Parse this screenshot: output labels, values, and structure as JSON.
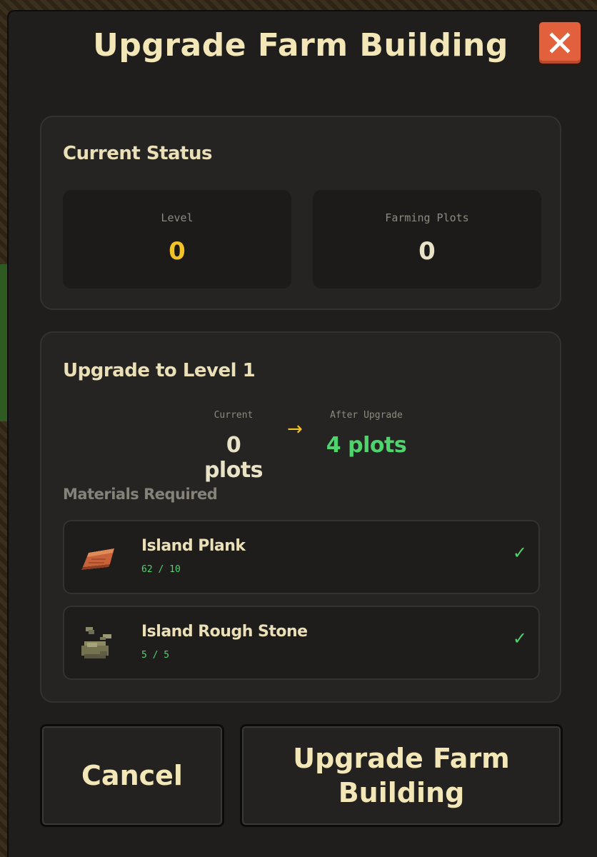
{
  "modal": {
    "title": "Upgrade Farm Building",
    "close_icon": "close-icon"
  },
  "current_status": {
    "heading": "Current Status",
    "level_label": "Level",
    "level_value": "0",
    "plots_label": "Farming Plots",
    "plots_value": "0"
  },
  "upgrade": {
    "heading": "Upgrade to Level 1",
    "current_label": "Current",
    "current_value": "0 plots",
    "arrow": "→",
    "after_label": "After Upgrade",
    "after_value": "4 plots",
    "materials_label": "Materials Required",
    "materials": [
      {
        "name": "Island Plank",
        "quantity": "62 / 10",
        "status": "✓",
        "icon": "plank-icon"
      },
      {
        "name": "Island Rough Stone",
        "quantity": "5 / 5",
        "status": "✓",
        "icon": "rough-stone-icon"
      }
    ]
  },
  "actions": {
    "cancel_label": "Cancel",
    "confirm_label": "Upgrade Farm Building"
  },
  "colors": {
    "accent_gold": "#f2c325",
    "success_green": "#4fd36c",
    "close_red": "#e2603c",
    "title_cream": "#f3e7b8"
  }
}
